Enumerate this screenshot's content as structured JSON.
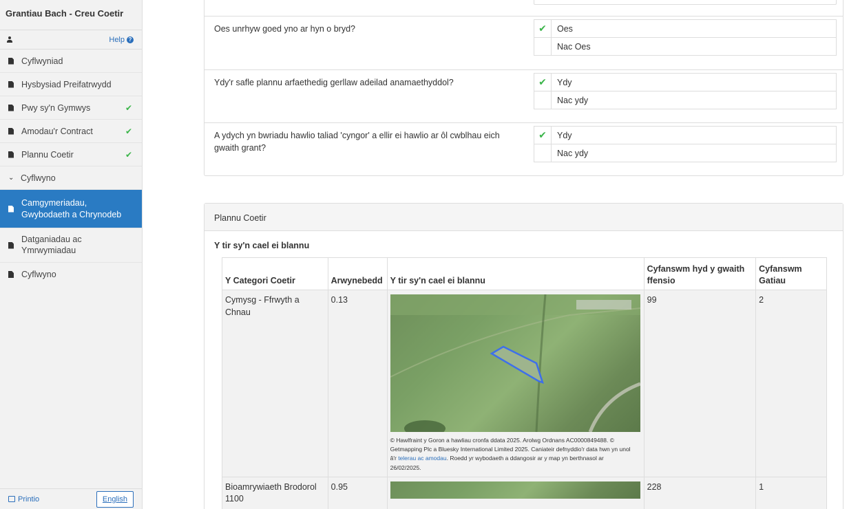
{
  "sidebar": {
    "title": "Grantiau Bach - Creu Coetir",
    "help_label": "Help",
    "items": [
      {
        "label": "Cyflwyniad",
        "done": false
      },
      {
        "label": "Hysbysiad Preifatrwydd",
        "done": false
      },
      {
        "label": "Pwy sy'n Gymwys",
        "done": true
      },
      {
        "label": "Amodau'r Contract",
        "done": true
      },
      {
        "label": "Plannu Coetir",
        "done": true
      },
      {
        "label": "Cyflwyno",
        "expanded": true
      },
      {
        "label": "Camgymeriadau, Gwybodaeth a Chrynodeb",
        "active": true
      },
      {
        "label": "Datganiadau ac Ymrwymiadau"
      },
      {
        "label": "Cyflwyno"
      }
    ],
    "print_label": "Printio",
    "lang_label": "English"
  },
  "questions": [
    {
      "text": "Oes unrhyw goed yno ar hyn o bryd?",
      "options": [
        "Oes",
        "Nac Oes"
      ],
      "selected": 0
    },
    {
      "text": "Ydy'r safle plannu arfaethedig gerllaw adeilad anamaethyddol?",
      "options": [
        "Ydy",
        "Nac ydy"
      ],
      "selected": 0
    },
    {
      "text": "A ydych yn bwriadu hawlio taliad 'cyngor' a ellir ei hawlio ar ôl cwblhau eich gwaith grant?",
      "options": [
        "Ydy",
        "Nac ydy"
      ],
      "selected": 0
    }
  ],
  "check_mark": "✔",
  "planting": {
    "panel_title": "Plannu Coetir",
    "section_title": "Y tir sy'n cael ei blannu",
    "columns": [
      "Y Categori Coetir",
      "Arwynebedd",
      "Y tir sy'n cael ei blannu",
      "Cyfanswm hyd y gwaith ffensio",
      "Cyfanswm Gatiau"
    ],
    "rows": [
      {
        "category": "Cymysg - Ffrwyth a Chnau",
        "area": "0.13",
        "fencing": "99",
        "gates": "2",
        "copyright_a": "© Hawlfraint y Goron a hawliau cronfa ddata 2025. Arolwg Ordnans AC0000849488. © Getmapping Plc a Bluesky International Limited 2025. Caniateir defnyddio'r data hwn yn unol â'r ",
        "copyright_link": "telerau ac amodau",
        "copyright_b": ". Roedd yr wybodaeth a ddangosir ar y map yn berthnasol ar 26/02/2025."
      },
      {
        "category": "Bioamrywiaeth Brodorol 1100",
        "area": "0.95",
        "fencing": "228",
        "gates": "1"
      }
    ]
  },
  "colors": {
    "accent": "#2a7bc3",
    "check": "#3bb54a",
    "link": "#2a6ebb"
  }
}
